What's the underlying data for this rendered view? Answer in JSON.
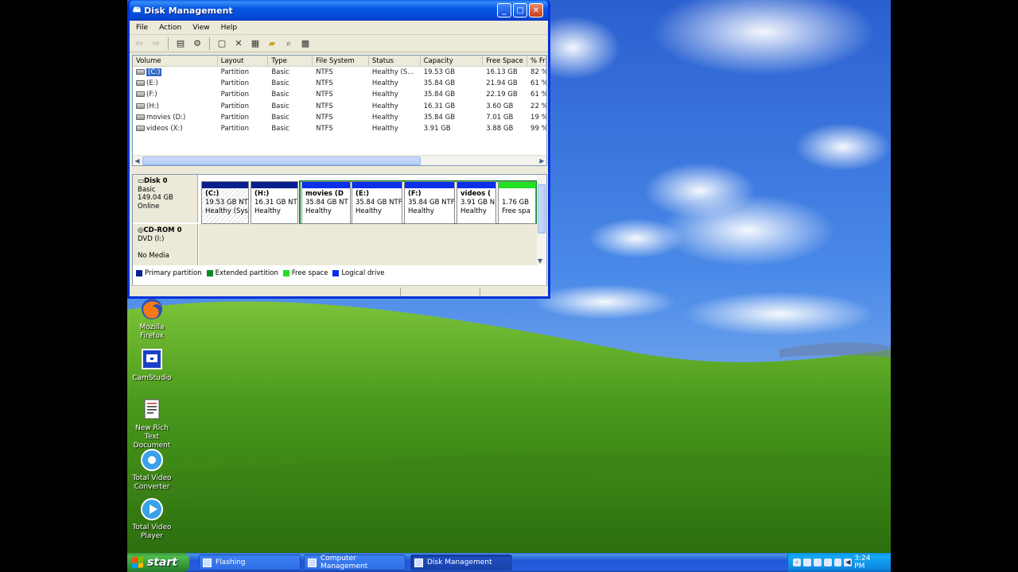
{
  "window": {
    "title": "Disk Management",
    "menu": [
      "File",
      "Action",
      "View",
      "Help"
    ]
  },
  "volume_list": {
    "columns": [
      "Volume",
      "Layout",
      "Type",
      "File System",
      "Status",
      "Capacity",
      "Free Space",
      "% Fr"
    ],
    "rows": [
      [
        "(C:)",
        "Partition",
        "Basic",
        "NTFS",
        "Healthy (S...",
        "19.53 GB",
        "16.13 GB",
        "82 %"
      ],
      [
        "(E:)",
        "Partition",
        "Basic",
        "NTFS",
        "Healthy",
        "35.84 GB",
        "21.94 GB",
        "61 %"
      ],
      [
        "(F:)",
        "Partition",
        "Basic",
        "NTFS",
        "Healthy",
        "35.84 GB",
        "22.19 GB",
        "61 %"
      ],
      [
        "(H:)",
        "Partition",
        "Basic",
        "NTFS",
        "Healthy",
        "16.31 GB",
        "3.60 GB",
        "22 %"
      ],
      [
        "movies (D:)",
        "Partition",
        "Basic",
        "NTFS",
        "Healthy",
        "35.84 GB",
        "7.01 GB",
        "19 %"
      ],
      [
        "videos (X:)",
        "Partition",
        "Basic",
        "NTFS",
        "Healthy",
        "3.91 GB",
        "3.88 GB",
        "99 %"
      ]
    ]
  },
  "disks": {
    "disk0": {
      "name": "Disk 0",
      "type": "Basic",
      "size": "149.04 GB",
      "state": "Online"
    },
    "cdrom0": {
      "name": "CD-ROM 0",
      "drive": "DVD (I:)",
      "media": "No Media"
    }
  },
  "partitions": [
    {
      "name": "(C:)",
      "size": "19.53 GB NT",
      "status": "Healthy (Sys",
      "color": "#0a1f8f"
    },
    {
      "name": "(H:)",
      "size": "16.31 GB NT",
      "status": "Healthy",
      "color": "#0a1f8f"
    },
    {
      "name": "movies (D",
      "size": "35.84 GB NT",
      "status": "Healthy",
      "color": "#0a30e8"
    },
    {
      "name": "(E:)",
      "size": "35.84 GB NTF",
      "status": "Healthy",
      "color": "#0a30e8"
    },
    {
      "name": "(F:)",
      "size": "35.84 GB NTF",
      "status": "Healthy",
      "color": "#0a30e8"
    },
    {
      "name": "videos (",
      "size": "3.91 GB N",
      "status": "Healthy",
      "color": "#0a30e8"
    },
    {
      "name": "",
      "size": "1.76 GB",
      "status": "Free spa",
      "color": "#22e022"
    }
  ],
  "legend": {
    "primary": "Primary partition",
    "extended": "Extended partition",
    "free": "Free space",
    "logical": "Logical drive",
    "colors": {
      "primary": "#0a1f8f",
      "extended": "#0a8a20",
      "free": "#22e022",
      "logical": "#0a30e8"
    }
  },
  "desktop_icons": [
    {
      "label": "Mozilla Firefox"
    },
    {
      "label": "CamStudio"
    },
    {
      "label": "New Rich Text Document"
    },
    {
      "label": "Total Video Converter"
    },
    {
      "label": "Total Video Player"
    }
  ],
  "taskbar": {
    "start": "start",
    "tasks": [
      "Flashing",
      "Computer Management",
      "Disk Management"
    ],
    "clock": "3:24 PM"
  }
}
